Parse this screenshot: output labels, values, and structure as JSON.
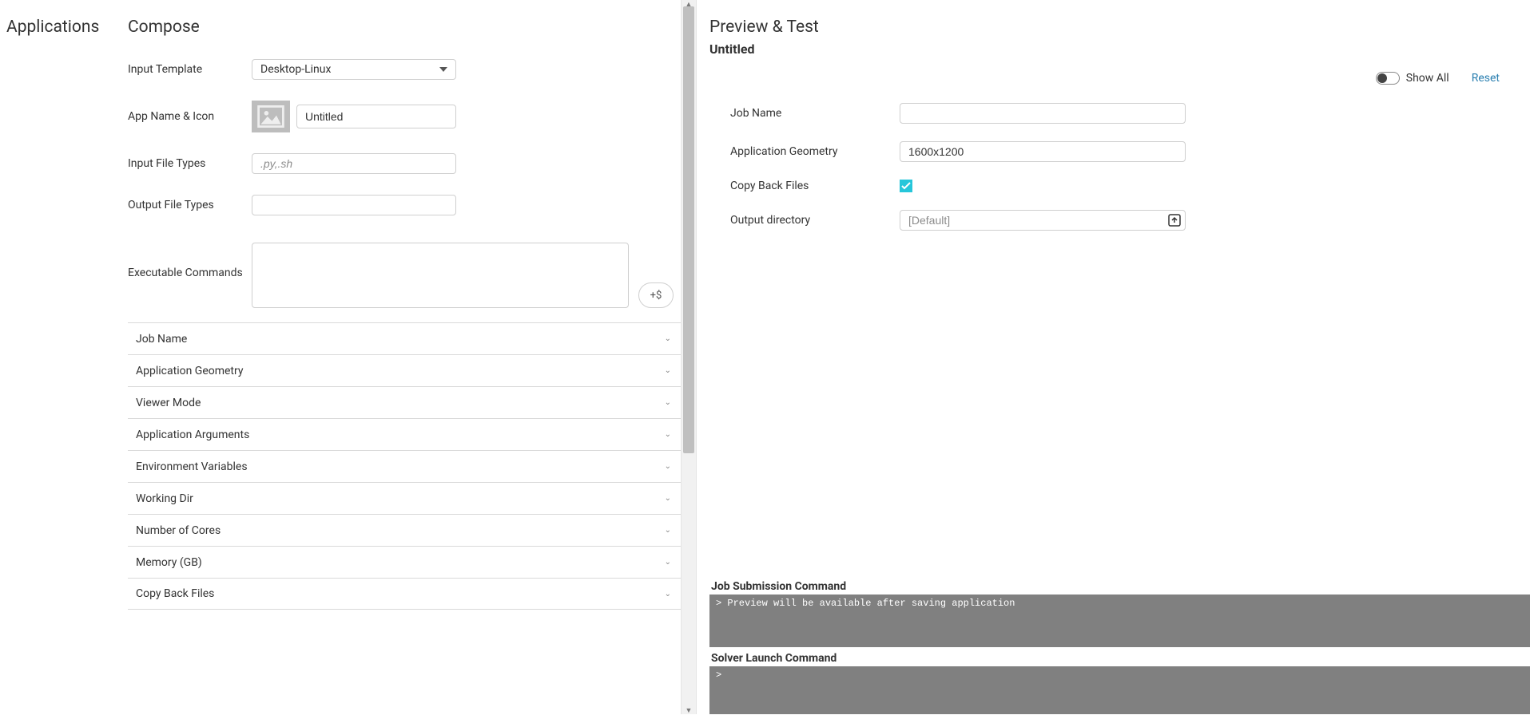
{
  "nav": {
    "title": "Applications"
  },
  "compose": {
    "title": "Compose",
    "labels": {
      "input_template": "Input Template",
      "app_name_icon": "App Name & Icon",
      "input_file_types": "Input File Types",
      "output_file_types": "Output File Types",
      "executable_commands": "Executable Commands"
    },
    "values": {
      "input_template_selected": "Desktop-Linux",
      "app_name": "Untitled",
      "input_file_types_placeholder": ".py,.sh",
      "add_var_label": "+$"
    },
    "accordion": [
      "Job Name",
      "Application Geometry",
      "Viewer Mode",
      "Application Arguments",
      "Environment Variables",
      "Working Dir",
      "Number of Cores",
      "Memory (GB)",
      "Copy Back Files"
    ]
  },
  "preview": {
    "title": "Preview & Test",
    "subtitle": "Untitled",
    "show_all_label": "Show All",
    "reset_label": "Reset",
    "fields": {
      "job_name_label": "Job Name",
      "job_name_value": "",
      "app_geometry_label": "Application Geometry",
      "app_geometry_value": "1600x1200",
      "copy_back_label": "Copy Back Files",
      "copy_back_checked": true,
      "output_dir_label": "Output directory",
      "output_dir_placeholder": "[Default]"
    },
    "job_submission": {
      "title": "Job Submission Command",
      "text": "> Preview will be available after saving application"
    },
    "solver_launch": {
      "title": "Solver Launch Command",
      "text": ">"
    }
  }
}
